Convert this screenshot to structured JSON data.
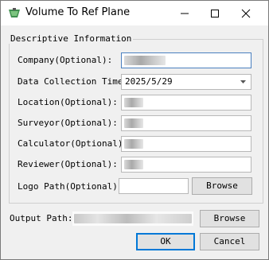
{
  "window": {
    "title": "Volume To Ref Plane",
    "icon": "shovel-app-icon",
    "controls": [
      "minimize-icon",
      "maximize-icon",
      "close-icon"
    ]
  },
  "group": {
    "legend": "Descriptive Information"
  },
  "fields": {
    "company": {
      "label": "Company(Optional):",
      "value": ""
    },
    "date": {
      "label": "Data Collection Time:",
      "value": "2025/5/29"
    },
    "location": {
      "label": "Location(Optional):",
      "value": ""
    },
    "surveyor": {
      "label": "Surveyor(Optional):",
      "value": ""
    },
    "calculator": {
      "label": "Calculator(Optional):",
      "value": ""
    },
    "reviewer": {
      "label": "Reviewer(Optional):",
      "value": ""
    },
    "logo": {
      "label": "Logo Path(Optional):",
      "value": "",
      "browse": "Browse"
    }
  },
  "output": {
    "label": "Output Path:",
    "value": "",
    "browse": "Browse"
  },
  "actions": {
    "ok": "OK",
    "cancel": "Cancel"
  },
  "colors": {
    "focus_border": "#4a7fbf",
    "default_button": "#0078d7"
  }
}
